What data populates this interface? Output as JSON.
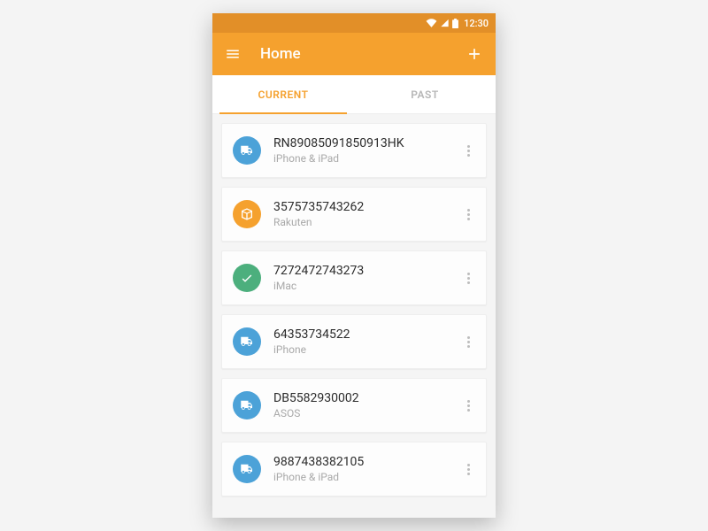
{
  "statusbar": {
    "time": "12:30"
  },
  "appbar": {
    "title": "Home"
  },
  "tabs": [
    {
      "label": "CURRENT",
      "active": true
    },
    {
      "label": "PAST",
      "active": false
    }
  ],
  "items": [
    {
      "avatarColor": "blue",
      "iconKind": "truck",
      "tracking": "RN89085091850913HK",
      "desc": "iPhone & iPad"
    },
    {
      "avatarColor": "orange",
      "iconKind": "box",
      "tracking": "3575735743262",
      "desc": "Rakuten"
    },
    {
      "avatarColor": "green",
      "iconKind": "check",
      "tracking": "7272472743273",
      "desc": "iMac"
    },
    {
      "avatarColor": "blue",
      "iconKind": "truck",
      "tracking": "64353734522",
      "desc": "iPhone"
    },
    {
      "avatarColor": "blue",
      "iconKind": "truck",
      "tracking": "DB5582930002",
      "desc": "ASOS"
    },
    {
      "avatarColor": "blue",
      "iconKind": "truck",
      "tracking": "9887438382105",
      "desc": "iPhone & iPad"
    }
  ]
}
